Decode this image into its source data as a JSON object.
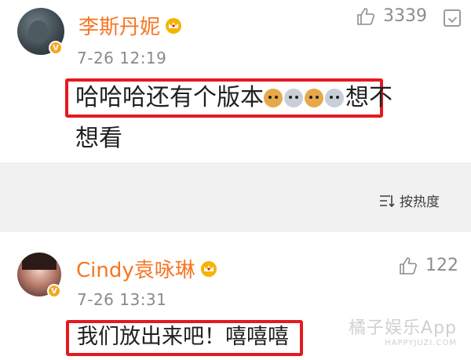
{
  "comments": [
    {
      "author": "李斯丹妮",
      "time": "7-26 12:19",
      "likes": "3339",
      "text_line1": "哈哈哈还有个版本",
      "text_after_emoji": "想不",
      "text_line2": "想看",
      "emojis": [
        "cat-emoji",
        "dog-emoji",
        "cat-emoji",
        "dog-emoji"
      ]
    },
    {
      "author": "Cindy袁咏琳",
      "time": "7-26 13:31",
      "likes": "122",
      "text": "我们放出来吧！嘻嘻嘻"
    }
  ],
  "sort_label": "按热度",
  "verified_mark": "V",
  "watermark": {
    "line1": "橘子娱乐App",
    "line2": "HAPPYJUZI.COM"
  },
  "colors": {
    "author": "#f77622",
    "highlight_box": "#e5191f",
    "verified": "#f5a623"
  }
}
